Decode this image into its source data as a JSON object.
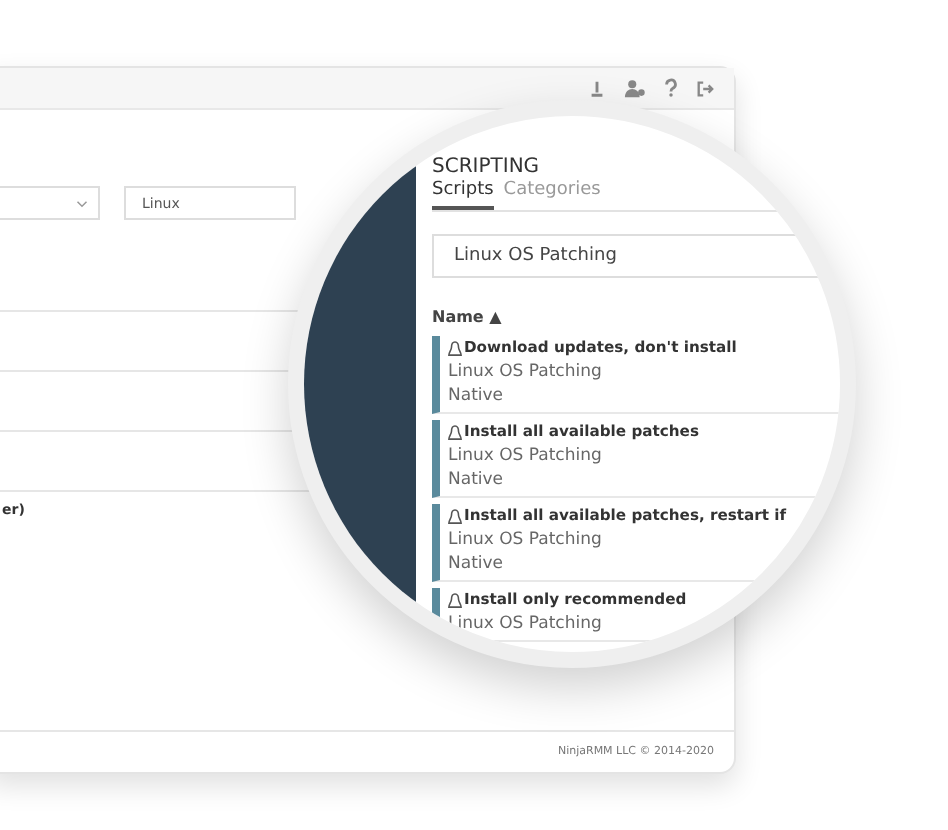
{
  "filters": {
    "os_field": {
      "value": "Linux"
    }
  },
  "list_fragment": "er)",
  "footer": "NinjaRMM LLC © 2014-2020",
  "magnifier": {
    "title": "SCRIPTING",
    "tabs": [
      {
        "label": "Scripts",
        "selected": true
      },
      {
        "label": "Categories",
        "selected": false
      }
    ],
    "search": {
      "value": "Linux OS Patching"
    },
    "sort_column": {
      "label": "Name",
      "arrow": "▲"
    },
    "scripts": [
      {
        "name": "Download updates, don't install",
        "category": "Linux OS Patching",
        "type": "Native"
      },
      {
        "name": "Install all available patches",
        "category": "Linux OS Patching",
        "type": "Native"
      },
      {
        "name": "Install all available patches, restart if",
        "category": "Linux OS Patching",
        "type": "Native"
      },
      {
        "name": "Install only recommended",
        "category": "Linux OS Patching"
      }
    ]
  }
}
